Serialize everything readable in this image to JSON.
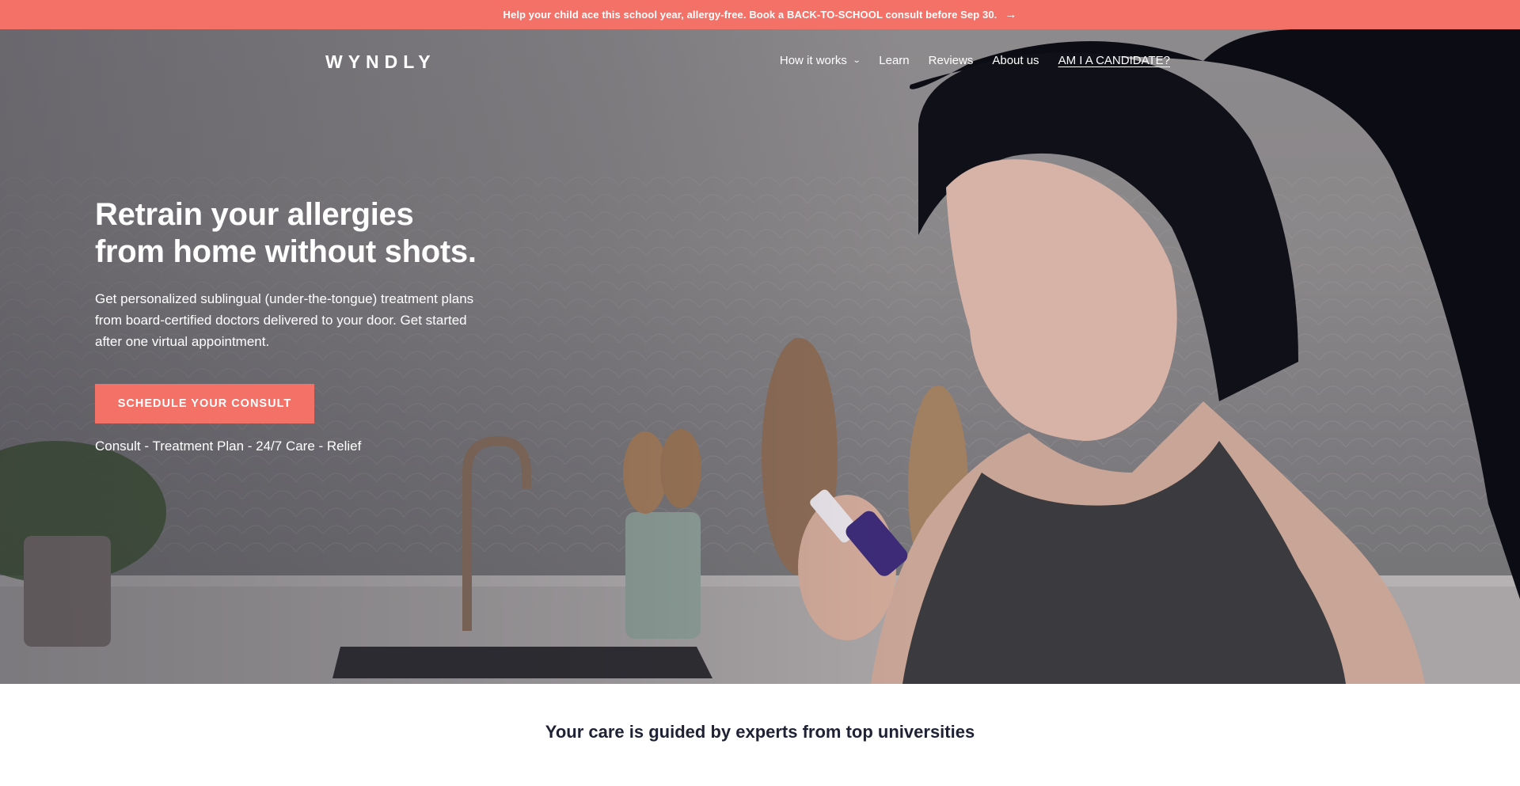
{
  "announcement": {
    "text": "Help your child ace this school year, allergy-free. Book a BACK-TO-SCHOOL consult before Sep 30.",
    "arrow": "→"
  },
  "nav": {
    "logo": "WYNDLY",
    "items": [
      {
        "label": "How it works",
        "has_dropdown": true
      },
      {
        "label": "Learn"
      },
      {
        "label": "Reviews"
      },
      {
        "label": "About us"
      },
      {
        "label": "AM I A CANDIDATE?"
      }
    ]
  },
  "hero": {
    "title": "Retrain your allergies from home without shots.",
    "subtitle": "Get personalized sublingual (under-the-tongue) treatment plans from board-certified doctors delivered to your door. Get started after one virtual appointment.",
    "cta_label": "SCHEDULE YOUR CONSULT",
    "steps": "Consult - Treatment Plan - 24/7 Care - Relief"
  },
  "experts_heading": "Your care is guided by experts from top universities",
  "colors": {
    "accent": "#f47168",
    "text_dark": "#1f2235",
    "white": "#ffffff"
  },
  "icons": {
    "announcement_arrow": "arrow-right-icon",
    "dropdown": "chevron-down-icon"
  }
}
